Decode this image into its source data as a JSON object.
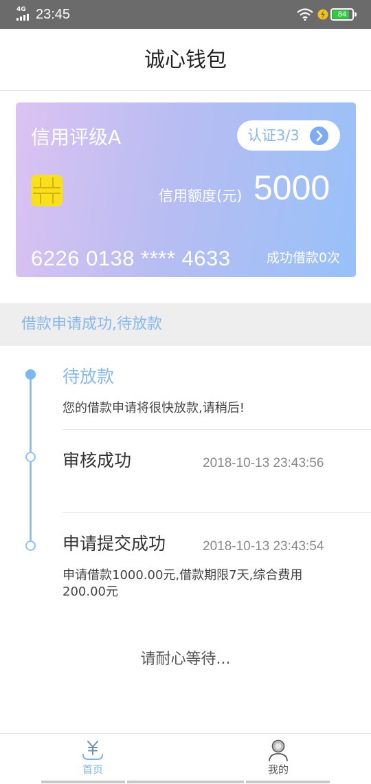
{
  "status_bar": {
    "network": "4G",
    "time": "23:45",
    "battery": "84",
    "battery_level": 0.84,
    "colors": {
      "bar": "#6b6b6b",
      "battery": "#2ecc40"
    }
  },
  "header": {
    "title": "诚心钱包"
  },
  "card": {
    "rating": "信用评级A",
    "cert_label": "认证3/3",
    "limit_label": "信用额度(元)",
    "limit_value": "5000",
    "card_number": "6226 0138 **** 4633",
    "loan_count": "成功借款0次",
    "icons": {
      "chip": "sim-chip-icon",
      "arrow": "chevron-right-icon"
    }
  },
  "status_strip": {
    "text": "借款申请成功,待放款"
  },
  "timeline": {
    "steps": [
      {
        "title": "待放款",
        "time": "",
        "desc": "您的借款申请将很快放款,请稍后!"
      },
      {
        "title": "审核成功",
        "time": "2018-10-13 23:43:56",
        "desc": ""
      },
      {
        "title": "申请提交成功",
        "time": "2018-10-13 23:43:54",
        "desc": "申请借款1000.00元,借款期限7天,综合费用200.00元"
      }
    ]
  },
  "wait_text": "请耐心等待...",
  "bottom_nav": {
    "items": [
      {
        "label": "首页",
        "icon": "yuan-icon",
        "active": true
      },
      {
        "label": "我的",
        "icon": "user-icon",
        "active": false
      }
    ]
  },
  "colors": {
    "accent": "#87b7ec",
    "chip": "#f9e01f"
  }
}
